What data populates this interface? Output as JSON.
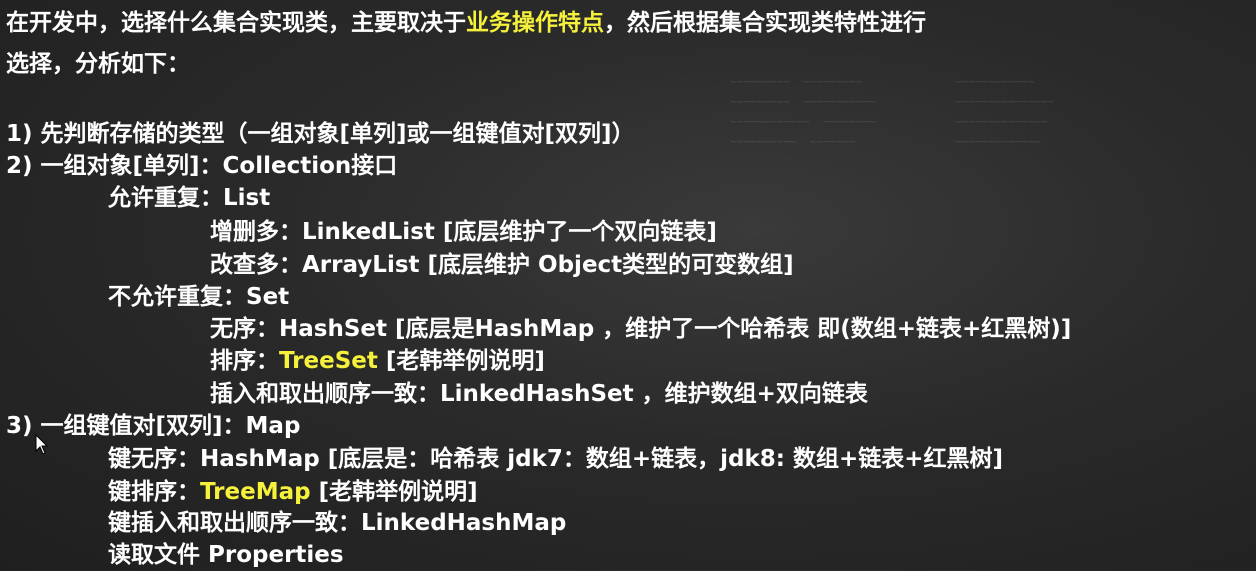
{
  "intro": {
    "part1": "在开发中，选择什么集合实现类，主要取决于",
    "highlight": "业务操作特点",
    "part2": "，然后根据集合实现类特性进行",
    "line2": "选择，分析如下："
  },
  "items": {
    "i1": "1) 先判断存储的类型（一组对象[单列]或一组键值对[双列]）",
    "i2": "2) 一组对象[单列]：Collection接口",
    "i2_allow": "允许重复：List",
    "i2_linked": "增删多：LinkedList [底层维护了一个双向链表]",
    "i2_array": "改查多：ArrayList [底层维护 Object类型的可变数组]",
    "i2_noallow": "不允许重复：Set",
    "i2_hashset": "无序：HashSet  [底层是HashMap ，维护了一个哈希表  即(数组+链表+红黑树)]",
    "i2_treeset_pre": "排序：",
    "i2_treeset_hl": "TreeSet",
    "i2_treeset_post": "  [老韩举例说明]",
    "i2_linkedhashset": "插入和取出顺序一致：LinkedHashSet ，维护数组+双向链表",
    "i3": "3) 一组键值对[双列]：Map",
    "i3_hashmap": "键无序：HashMap [底层是：哈希表  jdk7：数组+链表，jdk8: 数组+链表+红黑树]",
    "i3_treemap_pre": "键排序：",
    "i3_treemap_hl": "TreeMap",
    "i3_treemap_post": " [老韩举例说明]",
    "i3_linkedhashmap": "键插入和取出顺序一致：LinkedHashMap",
    "i3_properties": "读取文件  Properties"
  },
  "colors": {
    "highlight": "#f6f23c",
    "text": "#ffffff"
  },
  "icons": {
    "cursor": "mouse-pointer-icon"
  }
}
